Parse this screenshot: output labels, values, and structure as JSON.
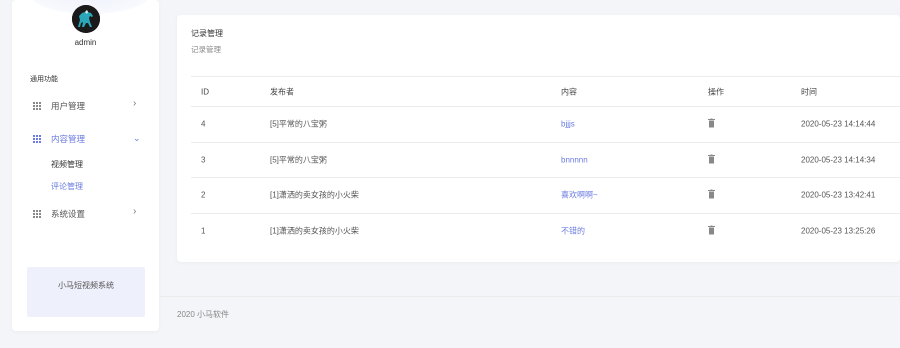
{
  "sidebar": {
    "user": {
      "name": "admin"
    },
    "section_label": "通用功能",
    "menu": [
      {
        "label": "用户管理",
        "arrow": "›",
        "expanded": false
      },
      {
        "label": "内容管理",
        "arrow": "⌄",
        "expanded": true,
        "children": [
          {
            "label": "视频管理",
            "active": false
          },
          {
            "label": "评论管理",
            "active": true
          }
        ]
      },
      {
        "label": "系统设置",
        "arrow": "›",
        "expanded": false
      }
    ],
    "brand": "小马短视频系统"
  },
  "main": {
    "title": "记录管理",
    "subtitle": "记录管理",
    "table": {
      "columns": [
        "ID",
        "发布者",
        "内容",
        "操作",
        "时间"
      ],
      "rows": [
        {
          "id": "4",
          "publisher": "[5]平常的八宝粥",
          "content": "bjjjs",
          "time": "2020-05-23 14:14:44"
        },
        {
          "id": "3",
          "publisher": "[5]平常的八宝粥",
          "content": "bnnnnn",
          "time": "2020-05-23 14:14:34"
        },
        {
          "id": "2",
          "publisher": "[1]潇洒的卖女孩的小火柴",
          "content": "喜欢啊啊~",
          "time": "2020-05-23 13:42:41"
        },
        {
          "id": "1",
          "publisher": "[1]潇洒的卖女孩的小火柴",
          "content": "不错的",
          "time": "2020-05-23 13:25:26"
        }
      ]
    }
  },
  "footer": {
    "text": "2020 小马软件"
  },
  "colors": {
    "accent": "#6b7be0",
    "background": "#f4f5f8",
    "card": "#ffffff"
  }
}
